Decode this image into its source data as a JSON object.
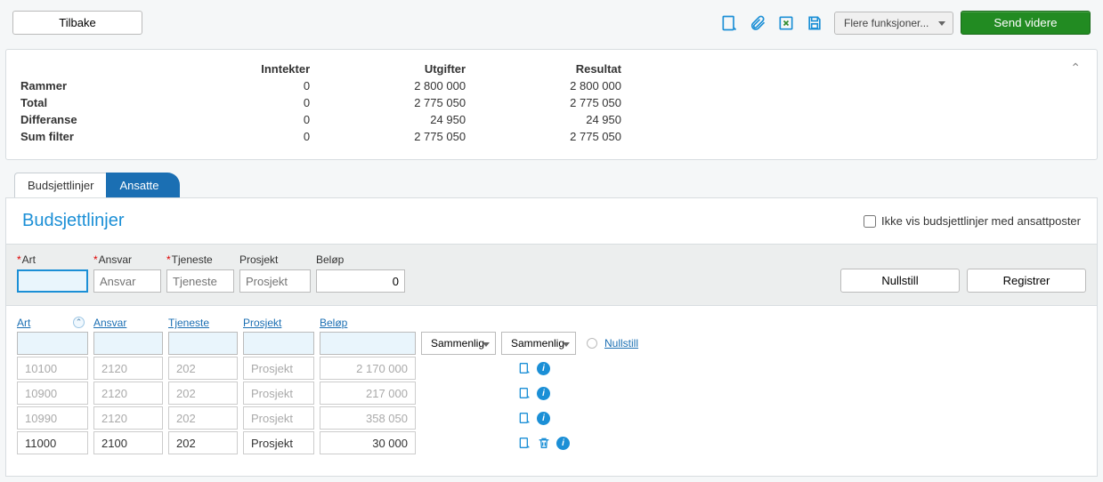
{
  "toolbar": {
    "back_label": "Tilbake",
    "more_functions_label": "Flere funksjoner...",
    "send_label": "Send videre"
  },
  "summary": {
    "headers": {
      "income": "Inntekter",
      "expenses": "Utgifter",
      "result": "Resultat"
    },
    "rows": [
      {
        "label": "Rammer",
        "income": "0",
        "expenses": "2 800 000",
        "result": "2 800 000"
      },
      {
        "label": "Total",
        "income": "0",
        "expenses": "2 775 050",
        "result": "2 775 050"
      },
      {
        "label": "Differanse",
        "income": "0",
        "expenses": "24 950",
        "result": "24 950"
      },
      {
        "label": "Sum filter",
        "income": "0",
        "expenses": "2 775 050",
        "result": "2 775 050"
      }
    ]
  },
  "tabs": {
    "budget_lines": "Budsjettlinjer",
    "employees": "Ansatte"
  },
  "section": {
    "title": "Budsjettlinjer",
    "hide_employee_lines_label": "Ikke vis budsjettlinjer med ansattposter"
  },
  "entry": {
    "labels": {
      "art": "Art",
      "ansvar": "Ansvar",
      "tjeneste": "Tjeneste",
      "prosjekt": "Prosjekt",
      "belop": "Beløp"
    },
    "placeholders": {
      "ansvar": "Ansvar",
      "tjeneste": "Tjeneste",
      "prosjekt": "Prosjekt"
    },
    "values": {
      "belop": "0"
    },
    "reset_label": "Nullstill",
    "register_label": "Registrer"
  },
  "grid": {
    "headers": {
      "art": "Art",
      "ansvar": "Ansvar",
      "tjeneste": "Tjeneste",
      "prosjekt": "Prosjekt",
      "belop": "Beløp"
    },
    "compare_label": "Sammenlig",
    "reset_label": "Nullstill",
    "rows": [
      {
        "art": "10100",
        "ansvar": "2120",
        "tjeneste": "202",
        "prosjekt": "Prosjekt",
        "belop": "2 170 000",
        "muted": true,
        "editable": false
      },
      {
        "art": "10900",
        "ansvar": "2120",
        "tjeneste": "202",
        "prosjekt": "Prosjekt",
        "belop": "217 000",
        "muted": true,
        "editable": false
      },
      {
        "art": "10990",
        "ansvar": "2120",
        "tjeneste": "202",
        "prosjekt": "Prosjekt",
        "belop": "358 050",
        "muted": true,
        "editable": false
      },
      {
        "art": "11000",
        "ansvar": "2100",
        "tjeneste": "202",
        "prosjekt": "Prosjekt",
        "belop": "30 000",
        "muted": false,
        "editable": true
      }
    ]
  },
  "icons": {
    "note": "note-icon",
    "attach": "attach-icon",
    "excel": "excel-icon",
    "save": "save-icon",
    "note_small": "note-icon",
    "info": "info-icon",
    "trash": "trash-icon"
  }
}
